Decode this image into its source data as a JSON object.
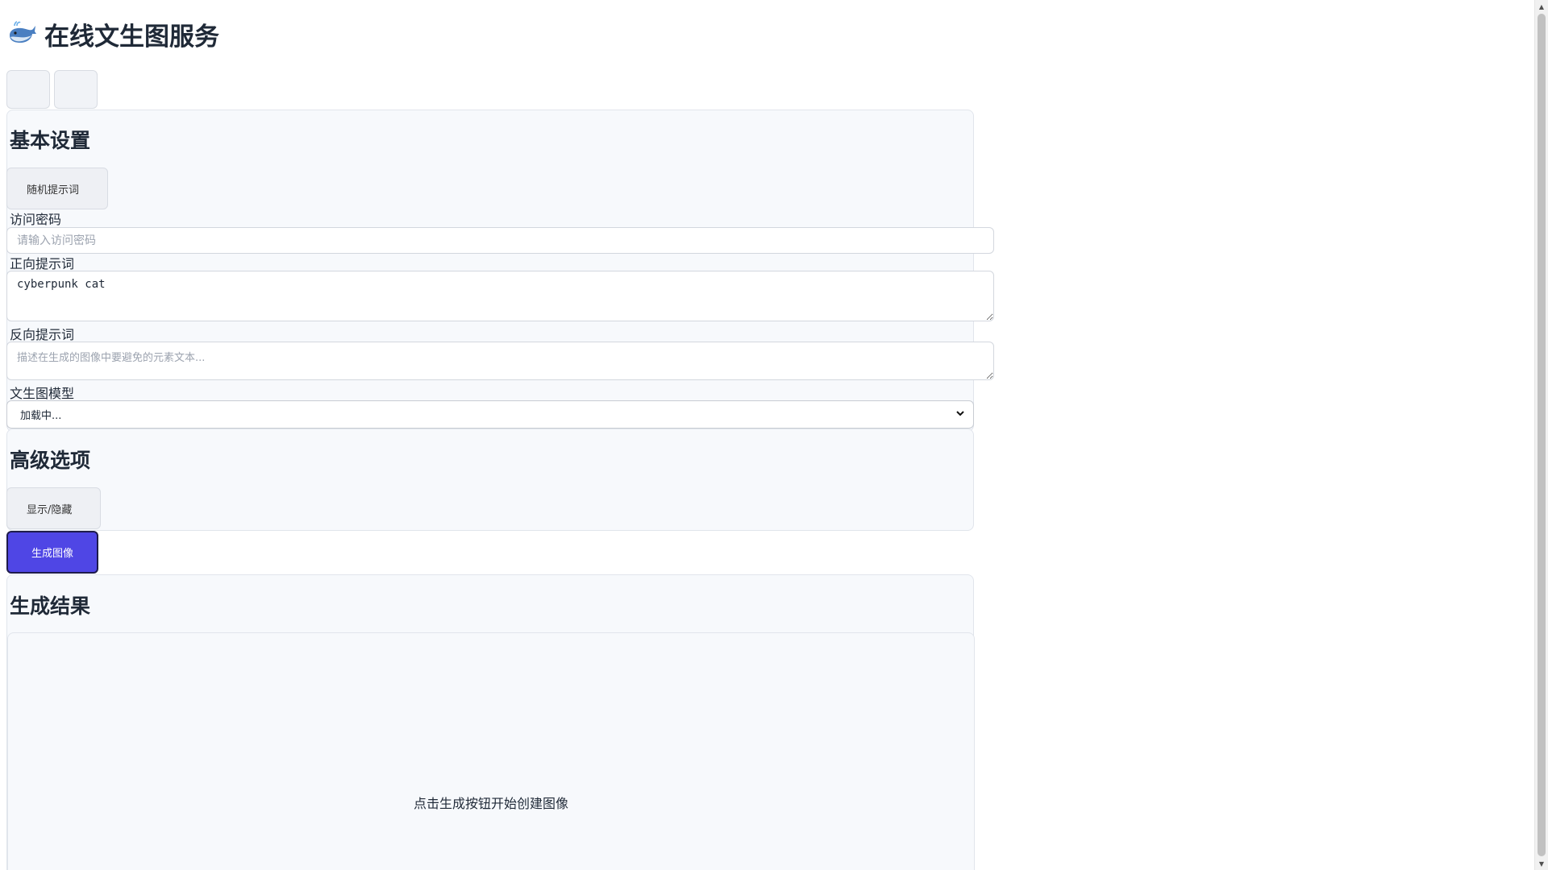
{
  "header": {
    "title": "在线文生图服务",
    "logo_icon": "whale-emoji"
  },
  "toolbar": {
    "button_a_icon": "",
    "button_b_icon": ""
  },
  "basic_settings": {
    "title_icon": "",
    "title": "基本设置",
    "random_prompt_button": " 随机提示词",
    "password_label_icon": "",
    "password_label": "访问密码",
    "password_placeholder": "请输入访问密码",
    "password_value": "",
    "positive_label_icon": "",
    "positive_label": "正向提示词",
    "positive_value": "cyberpunk cat",
    "negative_label_icon": "",
    "negative_label": "反向提示词",
    "negative_placeholder": "描述在生成的图像中要避免的元素文本...",
    "model_label_icon": "",
    "model_label": "文生图模型",
    "model_selected": "加载中..."
  },
  "advanced_options": {
    "title_icon": "",
    "title": "高级选项",
    "toggle_button": " 显示/隐藏"
  },
  "generate": {
    "button": " 生成图像",
    "color": "#4f46e5"
  },
  "result": {
    "title_icon": "",
    "title": "生成结果",
    "placeholder_icon": "",
    "hint": "点击生成按钮开始创建图像"
  }
}
